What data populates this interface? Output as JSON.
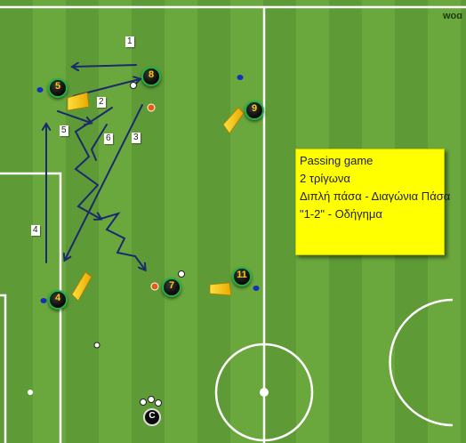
{
  "watermark": "woɑ",
  "info_box": {
    "line1": "Passing game",
    "line2": "2 τρίγωνα",
    "line3": "Διπλή πάσα - Διαγώνια Πάσα",
    "line4": "\"1-2\" - Οδήγημα"
  },
  "players": {
    "p5": "5",
    "p8": "8",
    "p9": "9",
    "p4": "4",
    "p7": "7",
    "p11": "11"
  },
  "coach": "C",
  "step_labels": {
    "s1": "1",
    "s2": "2",
    "s3": "3",
    "s4": "4",
    "s5": "5",
    "s6": "6"
  },
  "colors": {
    "arrow": "#1a2a6c",
    "player_ring": "#1db24a",
    "player_number": "#ffcc00",
    "info_box": "#ffff00",
    "cone": "#1030c0",
    "mannequin": "#ffd21a"
  }
}
